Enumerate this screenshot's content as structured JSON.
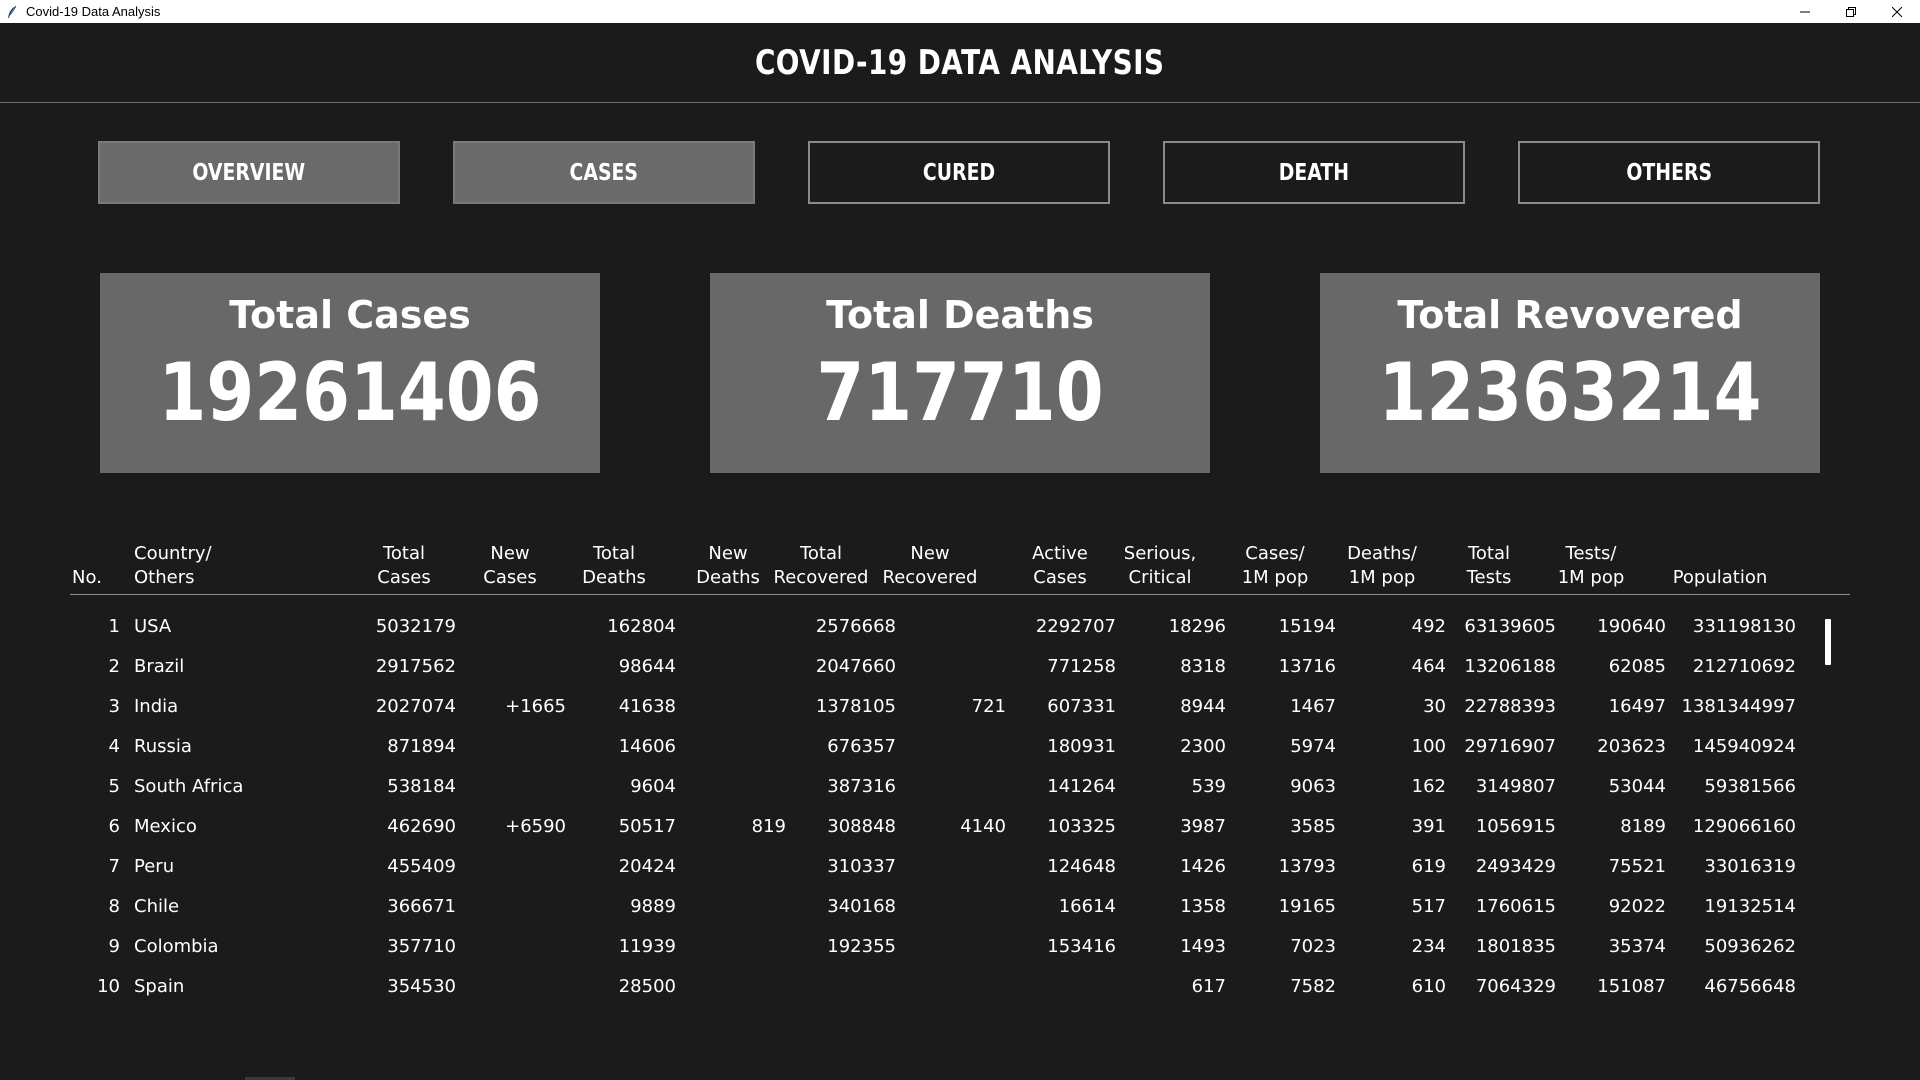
{
  "window": {
    "title": "Covid-19 Data Analysis"
  },
  "header": {
    "title": "COVID-19 DATA ANALYSIS"
  },
  "nav": [
    {
      "label": "OVERVIEW",
      "active": true
    },
    {
      "label": "CASES",
      "active": true
    },
    {
      "label": "CURED",
      "active": false
    },
    {
      "label": "DEATH",
      "active": false
    },
    {
      "label": "OTHERS",
      "active": false
    }
  ],
  "cards": {
    "cases": {
      "title": "Total Cases",
      "value": "19261406"
    },
    "deaths": {
      "title": "Total Deaths",
      "value": "717710"
    },
    "recovered": {
      "title": "Total Revovered",
      "value": "12363214"
    }
  },
  "table": {
    "headers": [
      [
        "No."
      ],
      [
        "Country/",
        "Others"
      ],
      [
        "Total",
        "Cases"
      ],
      [
        "New",
        "Cases"
      ],
      [
        "Total",
        "Deaths"
      ],
      [
        "New",
        "Deaths"
      ],
      [
        "Total",
        "Recovered"
      ],
      [
        "New",
        "Recovered"
      ],
      [
        "Active",
        "Cases"
      ],
      [
        "Serious,",
        "Critical"
      ],
      [
        "Cases/",
        "1M pop"
      ],
      [
        "Deaths/",
        "1M pop"
      ],
      [
        "Total",
        "Tests"
      ],
      [
        "Tests/",
        "1M pop"
      ],
      [
        "Population"
      ]
    ],
    "rows": [
      [
        "1",
        "USA",
        "5032179",
        "",
        "162804",
        "",
        "2576668",
        "",
        "2292707",
        "18296",
        "15194",
        "492",
        "63139605",
        "190640",
        "331198130"
      ],
      [
        "2",
        "Brazil",
        "2917562",
        "",
        "98644",
        "",
        "2047660",
        "",
        "771258",
        "8318",
        "13716",
        "464",
        "13206188",
        "62085",
        "212710692"
      ],
      [
        "3",
        "India",
        "2027074",
        "+1665",
        "41638",
        "",
        "1378105",
        "721",
        "607331",
        "8944",
        "1467",
        "30",
        "22788393",
        "16497",
        "1381344997"
      ],
      [
        "4",
        "Russia",
        "871894",
        "",
        "14606",
        "",
        "676357",
        "",
        "180931",
        "2300",
        "5974",
        "100",
        "29716907",
        "203623",
        "145940924"
      ],
      [
        "5",
        "South Africa",
        "538184",
        "",
        "9604",
        "",
        "387316",
        "",
        "141264",
        "539",
        "9063",
        "162",
        "3149807",
        "53044",
        "59381566"
      ],
      [
        "6",
        "Mexico",
        "462690",
        "+6590",
        "50517",
        "819",
        "308848",
        "4140",
        "103325",
        "3987",
        "3585",
        "391",
        "1056915",
        "8189",
        "129066160"
      ],
      [
        "7",
        "Peru",
        "455409",
        "",
        "20424",
        "",
        "310337",
        "",
        "124648",
        "1426",
        "13793",
        "619",
        "2493429",
        "75521",
        "33016319"
      ],
      [
        "8",
        "Chile",
        "366671",
        "",
        "9889",
        "",
        "340168",
        "",
        "16614",
        "1358",
        "19165",
        "517",
        "1760615",
        "92022",
        "19132514"
      ],
      [
        "9",
        "Colombia",
        "357710",
        "",
        "11939",
        "",
        "192355",
        "",
        "153416",
        "1493",
        "7023",
        "234",
        "1801835",
        "35374",
        "50936262"
      ],
      [
        "10",
        "Spain",
        "354530",
        "",
        "28500",
        "",
        "",
        "",
        "",
        "617",
        "7582",
        "610",
        "7064329",
        "151087",
        "46756648"
      ]
    ]
  }
}
